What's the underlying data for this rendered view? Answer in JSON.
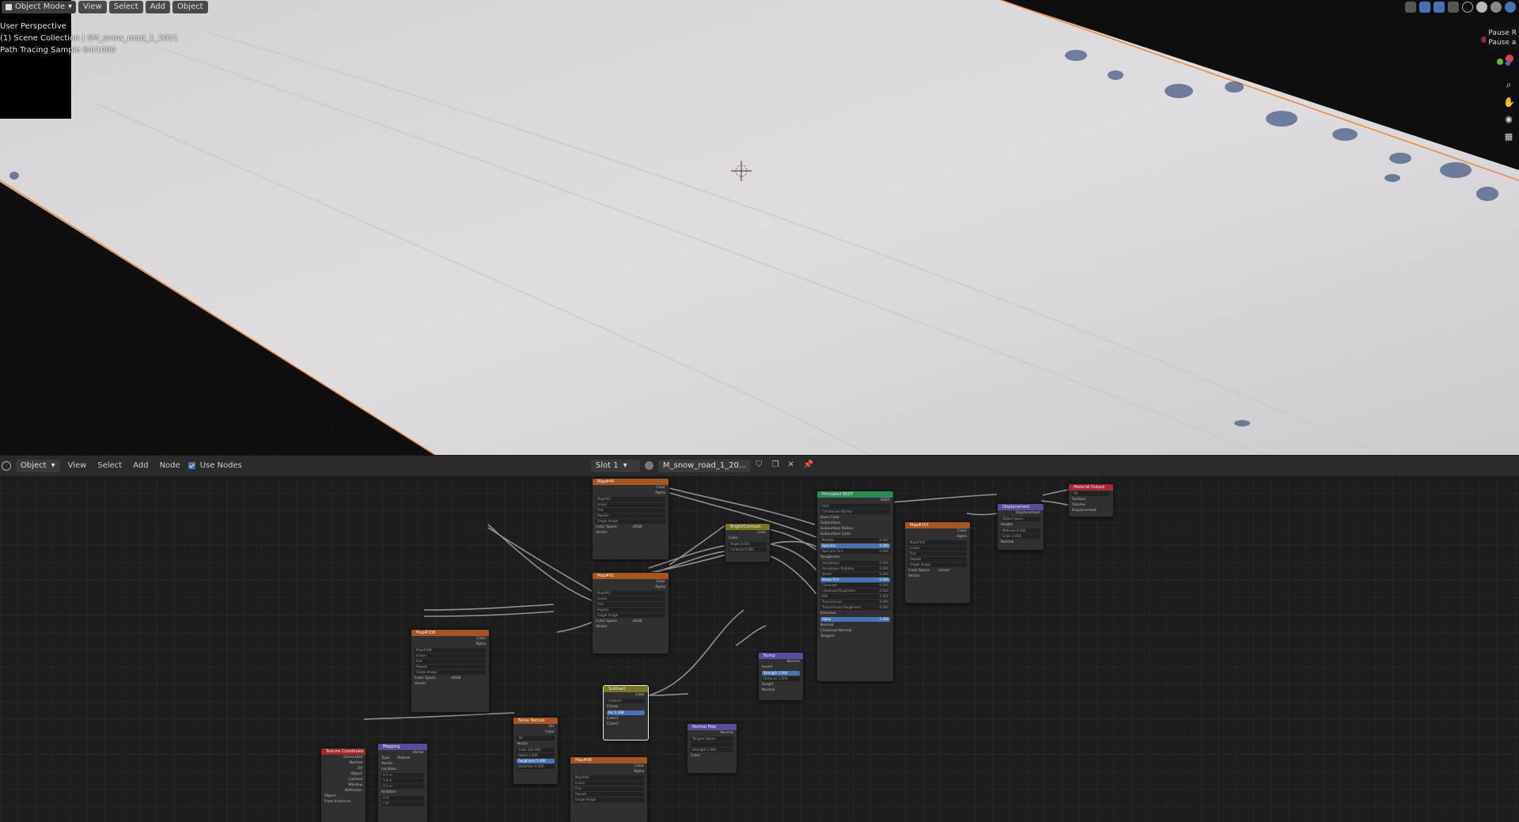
{
  "viewport": {
    "mode_label": "Object Mode",
    "menus": [
      "View",
      "Select",
      "Add",
      "Object"
    ],
    "overlay_lines": [
      "User Perspective",
      "(1) Scene Collection | SM_snow_road_1_2021",
      "Path Tracing Sample 64/1000"
    ],
    "tooltip_lines": [
      "Pause R",
      "Pause a"
    ]
  },
  "node_header": {
    "editor_type_label": "Object",
    "menus": [
      "View",
      "Select",
      "Add",
      "Node"
    ],
    "use_nodes_label": "Use Nodes",
    "slot_label": "Slot 1",
    "material_name": "M_snow_road_1_20..."
  },
  "nodes": {
    "tex1": {
      "title": "Map#44",
      "image": "Map#44",
      "outputs": [
        "Color",
        "Alpha"
      ],
      "options": [
        "Linear",
        "Flat",
        "Repeat",
        "Single Image"
      ],
      "color_space_label": "Color Space",
      "color_space": "sRGB",
      "input": "Vector"
    },
    "tex2": {
      "title": "Map#92",
      "image": "Map#92",
      "outputs": [
        "Color",
        "Alpha"
      ],
      "options": [
        "Linear",
        "Flat",
        "Repeat",
        "Single Image"
      ],
      "color_space_label": "Color Space",
      "color_space": "sRGB",
      "input": "Vector"
    },
    "tex3": {
      "title": "Map#108",
      "image": "Map#108",
      "outputs": [
        "Color",
        "Alpha"
      ],
      "options": [
        "Linear",
        "Flat",
        "Repeat",
        "Single Image"
      ],
      "color_space_label": "Color Space",
      "color_space": "sRGB",
      "input": "Vector"
    },
    "tex4": {
      "title": "Map#101",
      "image": "Map#101",
      "outputs": [
        "Color",
        "Alpha"
      ],
      "options": [
        "Linear",
        "Flat",
        "Repeat",
        "Single Image"
      ],
      "color_space_label": "Color Space",
      "color_space": "Linear",
      "input": "Vector"
    },
    "tex5": {
      "title": "Map#98",
      "image": "Map#98",
      "outputs": [
        "Color",
        "Alpha"
      ],
      "options": [
        "Linear",
        "Flat",
        "Repeat",
        "Single Image"
      ]
    },
    "brightcontrast": {
      "title": "Bright/Contrast",
      "output": "Color",
      "inputs": [
        "Color"
      ],
      "fields": [
        {
          "label": "Bright",
          "value": "0.000"
        },
        {
          "label": "Contrast",
          "value": "0.000"
        }
      ]
    },
    "principled": {
      "title": "Principled BSDF",
      "output": "BSDF",
      "dropdowns": [
        "GGX",
        "Christensen-Burley"
      ],
      "inputs": [
        "Base Color",
        "Subsurface",
        "Subsurface Radius",
        "Subsurface Color",
        "Metallic",
        "Specular",
        "Specular Tint",
        "Roughness",
        "Anisotropic",
        "Anisotropic Rotation",
        "Sheen",
        "Sheen Tint",
        "Clearcoat",
        "Clearcoat Roughness",
        "IOR",
        "Transmission",
        "Transmission Roughness",
        "Emission",
        "Alpha",
        "Normal",
        "Clearcoat Normal",
        "Tangent"
      ],
      "values": [
        "",
        "",
        "",
        "",
        "0.000",
        "0.500",
        "0.000",
        "",
        "0.000",
        "0.000",
        "0.000",
        "0.500",
        "0.000",
        "0.030",
        "1.450",
        "0.000",
        "0.000",
        "",
        "1.000",
        "",
        "",
        ""
      ]
    },
    "displacement": {
      "title": "Displacement",
      "output": "Displacement",
      "dropdown": "Object Space",
      "inputs": [
        "Height",
        "Midlevel",
        "Scale",
        "Normal"
      ],
      "values": [
        "",
        "0.500",
        "2.000",
        ""
      ]
    },
    "material_output": {
      "title": "Material Output",
      "dropdown": "All",
      "inputs": [
        "Surface",
        "Volume",
        "Displacement"
      ]
    },
    "mixrgb": {
      "title": "Subtract",
      "output": "Color",
      "dropdown": "Subtract",
      "clamp_label": "Clamp",
      "fac_label": "Fac",
      "fac": "0.208",
      "inputs": [
        "Color1",
        "Color2"
      ]
    },
    "bump": {
      "title": "Bump",
      "output": "Normal",
      "invert_label": "Invert",
      "fields": [
        {
          "label": "Strength",
          "value": "1.000"
        },
        {
          "label": "Distance",
          "value": "1.000"
        }
      ],
      "inputs": [
        "Height",
        "Normal"
      ]
    },
    "normalmap": {
      "title": "Normal Map",
      "output": "Normal",
      "dropdown": "Tangent Space",
      "fields": [
        {
          "label": "Strength",
          "value": "1.000"
        }
      ],
      "inputs": [
        "Color"
      ]
    },
    "noise": {
      "title": "Noise Texture",
      "outputs": [
        "Fac",
        "Color"
      ],
      "dropdown": "3D",
      "inputs": [
        "Vector"
      ],
      "fields": [
        {
          "label": "Scale",
          "value": "300.000"
        },
        {
          "label": "Detail",
          "value": "2.000"
        },
        {
          "label": "Roughness",
          "value": "0.400"
        },
        {
          "label": "Distortion",
          "value": "0.000"
        }
      ]
    },
    "mapping": {
      "title": "Mapping",
      "output": "Vector",
      "type_label": "Type",
      "type_value": "Texture",
      "inputs": [
        "Vector",
        "Location",
        "Rotation"
      ],
      "loc": [
        "X  0 m",
        "Y  0 m",
        "Z  0 m"
      ],
      "rot": [
        "X  0°",
        "Y  0°"
      ]
    },
    "texcoord": {
      "title": "Texture Coordinate",
      "outputs": [
        "Generated",
        "Normal",
        "UV",
        "Object",
        "Camera",
        "Window",
        "Reflection"
      ],
      "object_label": "Object",
      "extra": "From Instancer"
    }
  }
}
